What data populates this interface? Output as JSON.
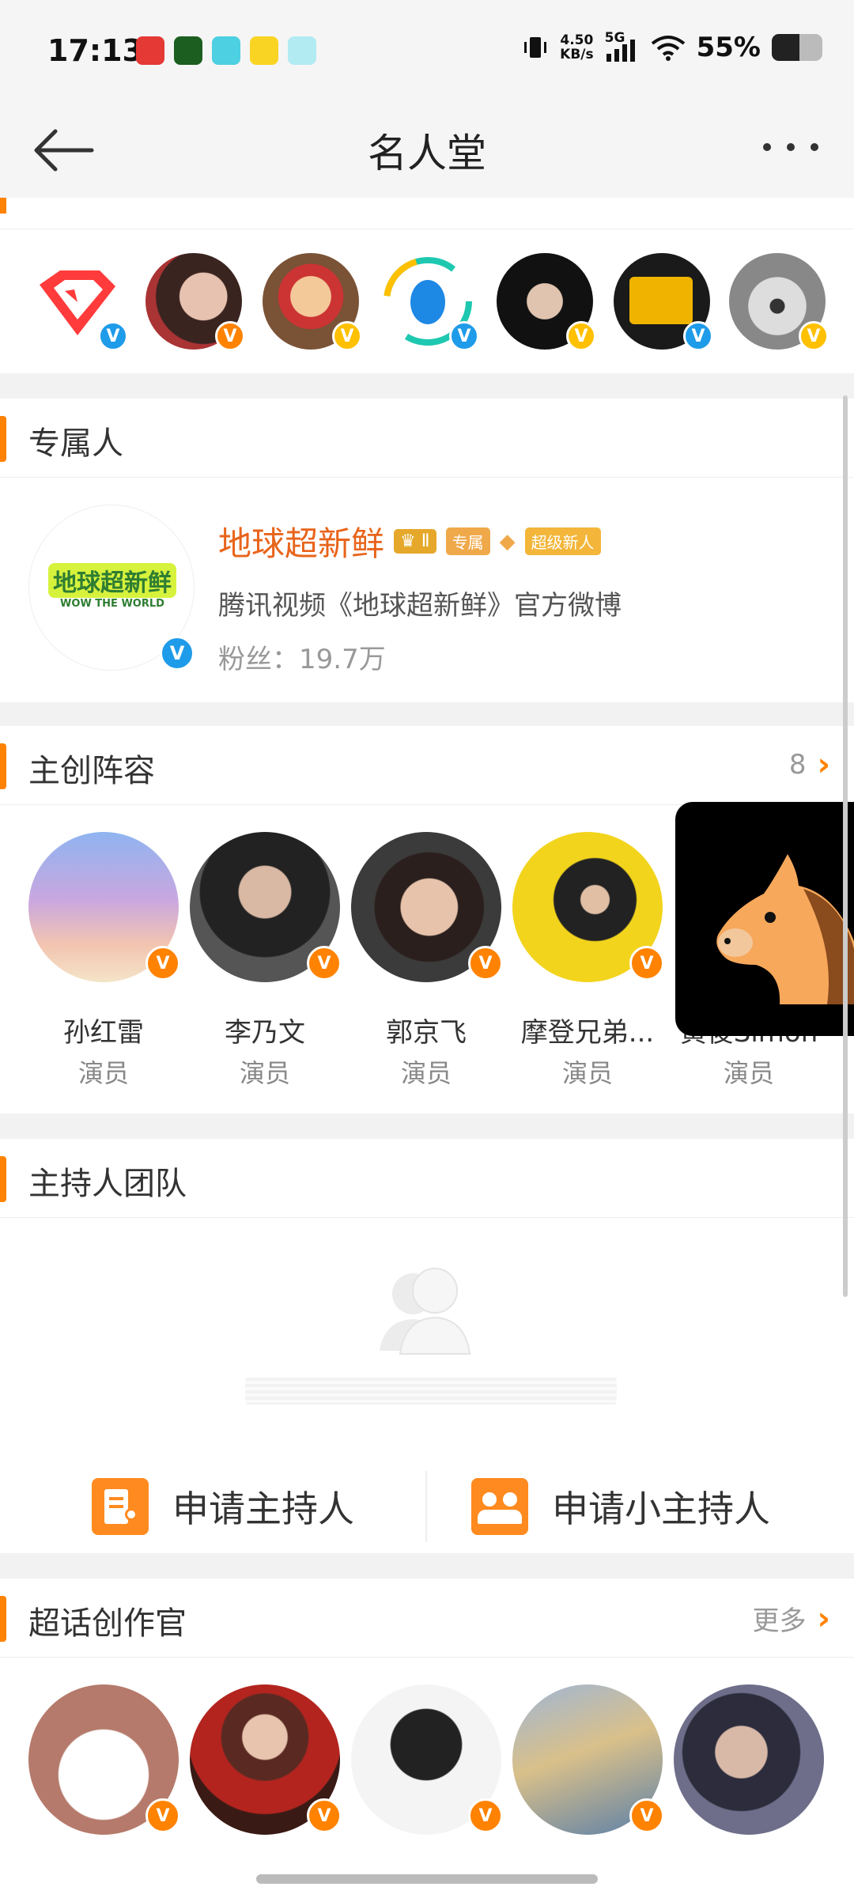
{
  "status_bar": {
    "time": "17:13",
    "net_speed_value": "4.50",
    "net_speed_unit": "KB/s",
    "network": "5G",
    "battery_pct": "55%",
    "battery_level": 0.55
  },
  "nav": {
    "title": "名人堂",
    "back_icon": "back-arrow-icon",
    "more_icon": "more-dots-icon"
  },
  "exclusive": {
    "title": "专属人",
    "name": "地球超新鲜",
    "tag_level": "Ⅱ",
    "tag_exclusive": "专属",
    "tag_new": "超级新人",
    "description": "腾讯视频《地球超新鲜》官方微博",
    "fans": "粉丝：19.7万",
    "avatar_text": "地球超新鲜",
    "avatar_subtext": "WOW THE WORLD"
  },
  "cast": {
    "title": "主创阵容",
    "count": "8",
    "members": [
      {
        "name": "孙红雷",
        "role": "演员"
      },
      {
        "name": "李乃文",
        "role": "演员"
      },
      {
        "name": "郭京飞",
        "role": "演员"
      },
      {
        "name": "摩登兄弟...",
        "role": "演员"
      },
      {
        "name": "黄俊Simon",
        "role": "演员"
      }
    ]
  },
  "hosts": {
    "title": "主持人团队",
    "apply_host": "申请主持人",
    "apply_junior_host": "申请小主持人"
  },
  "creators": {
    "title": "超话创作官",
    "more": "更多"
  },
  "colors": {
    "accent": "#ff8200",
    "verified_blue": "#1e9be9",
    "name_orange": "#e8641b"
  }
}
